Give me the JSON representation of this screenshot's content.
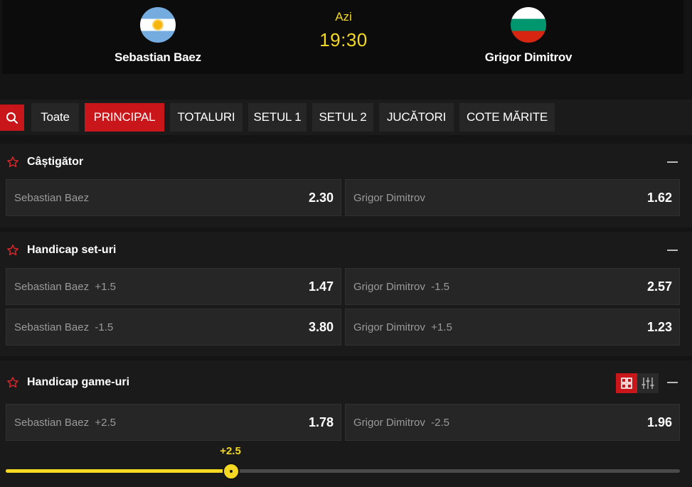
{
  "match": {
    "home": {
      "name": "Sebastian Baez",
      "flag": "argentina-flag"
    },
    "away": {
      "name": "Grigor Dimitrov",
      "flag": "bulgaria-flag"
    },
    "day": "Azi",
    "time": "19:30"
  },
  "tabs": [
    {
      "label": "Toate",
      "active": false
    },
    {
      "label": "PRINCIPAL",
      "active": true
    },
    {
      "label": "TOTALURI",
      "active": false
    },
    {
      "label": "SETUL 1",
      "active": false
    },
    {
      "label": "SETUL 2",
      "active": false
    },
    {
      "label": "JUCĂTORI",
      "active": false
    },
    {
      "label": "COTE MĂRITE",
      "active": false
    }
  ],
  "markets": {
    "winner": {
      "title": "Câștigător",
      "odds": [
        {
          "label": "Sebastian Baez",
          "value": "2.30"
        },
        {
          "label": "Grigor Dimitrov",
          "value": "1.62"
        }
      ]
    },
    "set_handicap": {
      "title": "Handicap set-uri",
      "odds": [
        {
          "label": "Sebastian Baez  +1.5",
          "value": "1.47"
        },
        {
          "label": "Grigor Dimitrov  -1.5",
          "value": "2.57"
        },
        {
          "label": "Sebastian Baez  -1.5",
          "value": "3.80"
        },
        {
          "label": "Grigor Dimitrov  +1.5",
          "value": "1.23"
        }
      ]
    },
    "game_handicap": {
      "title": "Handicap game-uri",
      "odds": [
        {
          "label": "Sebastian Baez  +2.5",
          "value": "1.78"
        },
        {
          "label": "Grigor Dimitrov  -2.5",
          "value": "1.96"
        }
      ],
      "slider": {
        "label": "+2.5",
        "fraction": 0.334
      }
    }
  },
  "colors": {
    "accent": "#c8161a",
    "highlight": "#f4d821",
    "background": "#141414"
  }
}
